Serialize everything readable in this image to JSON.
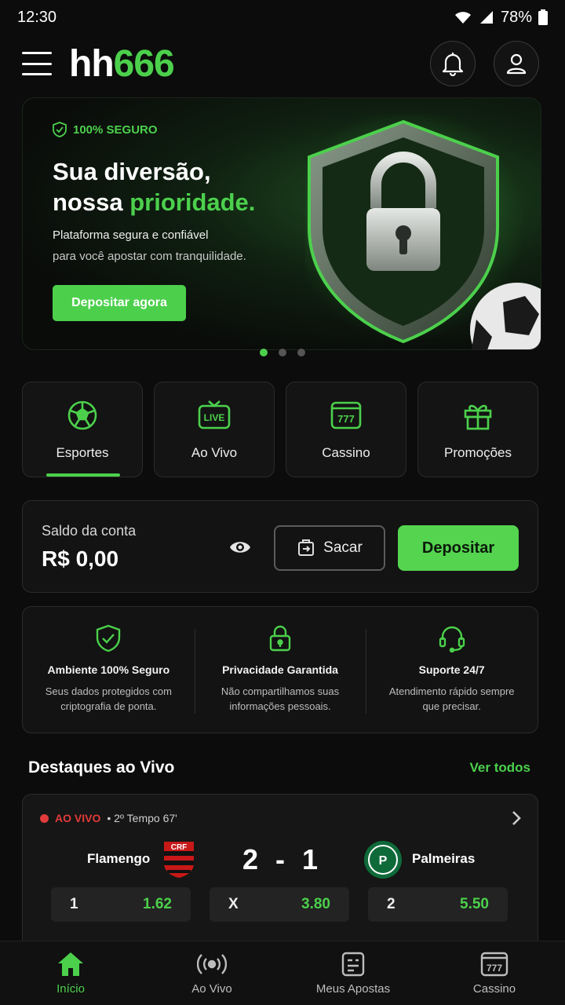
{
  "status": {
    "time": "12:30",
    "battery": "78%"
  },
  "brand": {
    "part1": "hh",
    "part2": "666",
    "accent": "#4cd04c"
  },
  "banner": {
    "badge": "100% SEGURO",
    "title_line1": "Sua diversão,",
    "title_line2_a": "nossa ",
    "title_line2_b": "prioridade.",
    "subtitle1": "Plataforma segura e confiável",
    "subtitle2": "para você apostar com tranquilidade.",
    "cta": "Depositar agora",
    "slides": 3,
    "active_slide": 1
  },
  "categories": [
    {
      "label": "Esportes",
      "icon": "soccer-ball-icon",
      "active": true
    },
    {
      "label": "Ao Vivo",
      "icon": "live-tv-icon",
      "active": false
    },
    {
      "label": "Cassino",
      "icon": "slot-machine-icon",
      "active": false
    },
    {
      "label": "Promoções",
      "icon": "gift-icon",
      "active": false
    }
  ],
  "balance": {
    "label": "Saldo da conta",
    "value": "R$ 0,00",
    "withdraw_label": "Sacar",
    "deposit_label": "Depositar"
  },
  "features": [
    {
      "title": "Ambiente 100% Seguro",
      "desc": "Seus dados protegidos com criptografia de ponta.",
      "icon": "shield-check-icon"
    },
    {
      "title": "Privacidade Garantida",
      "desc": "Não compartilhamos suas informações pessoais.",
      "icon": "lock-icon"
    },
    {
      "title": "Suporte 24/7",
      "desc": "Atendimento rápido sempre que precisar.",
      "icon": "headset-icon"
    }
  ],
  "live_section": {
    "title": "Destaques ao Vivo",
    "see_all": "Ver todos"
  },
  "match": {
    "status": "AO VIVO",
    "time": "• 2º Tempo 67'",
    "home": "Flamengo",
    "away": "Palmeiras",
    "home_score": "2",
    "separator": "-",
    "away_score": "1",
    "odds": [
      {
        "key": "1",
        "value": "1.62"
      },
      {
        "key": "X",
        "value": "3.80"
      },
      {
        "key": "2",
        "value": "5.50"
      }
    ]
  },
  "nav": [
    {
      "label": "Início",
      "icon": "home-icon",
      "active": true
    },
    {
      "label": "Ao Vivo",
      "icon": "broadcast-icon",
      "active": false
    },
    {
      "label": "Meus Apostas",
      "icon": "bet-slip-icon",
      "active": false
    },
    {
      "label": "Cassino",
      "icon": "slot-machine-icon",
      "active": false
    }
  ]
}
